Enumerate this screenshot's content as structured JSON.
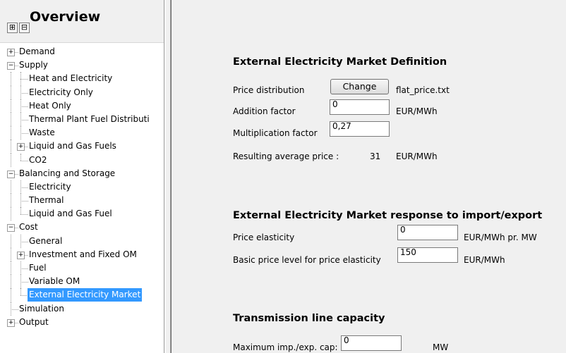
{
  "overview": {
    "title": "Overview",
    "expand_all": "⊞",
    "collapse_all": "⊟"
  },
  "tree": [
    {
      "label": "Demand",
      "level": 0,
      "expander": "+",
      "selected": false
    },
    {
      "label": "Supply",
      "level": 0,
      "expander": "-",
      "selected": false
    },
    {
      "label": "Heat and Electricity",
      "level": 1,
      "expander": null,
      "selected": false
    },
    {
      "label": "Electricity Only",
      "level": 1,
      "expander": null,
      "selected": false
    },
    {
      "label": "Heat Only",
      "level": 1,
      "expander": null,
      "selected": false
    },
    {
      "label": "Thermal Plant Fuel Distributi",
      "level": 1,
      "expander": null,
      "selected": false
    },
    {
      "label": "Waste",
      "level": 1,
      "expander": null,
      "selected": false
    },
    {
      "label": "Liquid and Gas Fuels",
      "level": 1,
      "expander": "+",
      "selected": false
    },
    {
      "label": "CO2",
      "level": 1,
      "expander": null,
      "selected": false
    },
    {
      "label": "Balancing and Storage",
      "level": 0,
      "expander": "-",
      "selected": false
    },
    {
      "label": "Electricity",
      "level": 1,
      "expander": null,
      "selected": false
    },
    {
      "label": "Thermal",
      "level": 1,
      "expander": null,
      "selected": false
    },
    {
      "label": "Liquid and Gas Fuel",
      "level": 1,
      "expander": null,
      "selected": false
    },
    {
      "label": "Cost",
      "level": 0,
      "expander": "-",
      "selected": false
    },
    {
      "label": "General",
      "level": 1,
      "expander": null,
      "selected": false
    },
    {
      "label": "Investment and Fixed OM",
      "level": 1,
      "expander": "+",
      "selected": false
    },
    {
      "label": "Fuel",
      "level": 1,
      "expander": null,
      "selected": false
    },
    {
      "label": "Variable OM",
      "level": 1,
      "expander": null,
      "selected": false
    },
    {
      "label": "External Electricity Market",
      "level": 1,
      "expander": null,
      "selected": true
    },
    {
      "label": "Simulation",
      "level": 0,
      "expander": null,
      "selected": false
    },
    {
      "label": "Output",
      "level": 0,
      "expander": "+",
      "selected": false
    }
  ],
  "market_definition": {
    "heading": "External Electricity Market Definition",
    "price_distribution_label": "Price distribution",
    "change_button": "Change",
    "price_file": "flat_price.txt",
    "addition_factor_label": "Addition factor",
    "addition_factor_value": "0",
    "addition_factor_unit": "EUR/MWh",
    "multiplication_factor_label": "Multiplication factor",
    "multiplication_factor_value": "0,27",
    "resulting_price_label": "Resulting average price :",
    "resulting_price_value": "31",
    "resulting_price_unit": "EUR/MWh"
  },
  "market_response": {
    "heading": "External Electricity Market response to import/export",
    "price_elasticity_label": "Price elasticity",
    "price_elasticity_value": "0",
    "price_elasticity_unit": "EUR/MWh pr. MW",
    "basic_price_label": "Basic price level for price elasticity",
    "basic_price_value": "150",
    "basic_price_unit": "EUR/MWh"
  },
  "transmission": {
    "heading": "Transmission line capacity",
    "max_cap_label": "Maximum imp./exp. cap:",
    "max_cap_value": "0",
    "max_cap_unit": "MW"
  }
}
